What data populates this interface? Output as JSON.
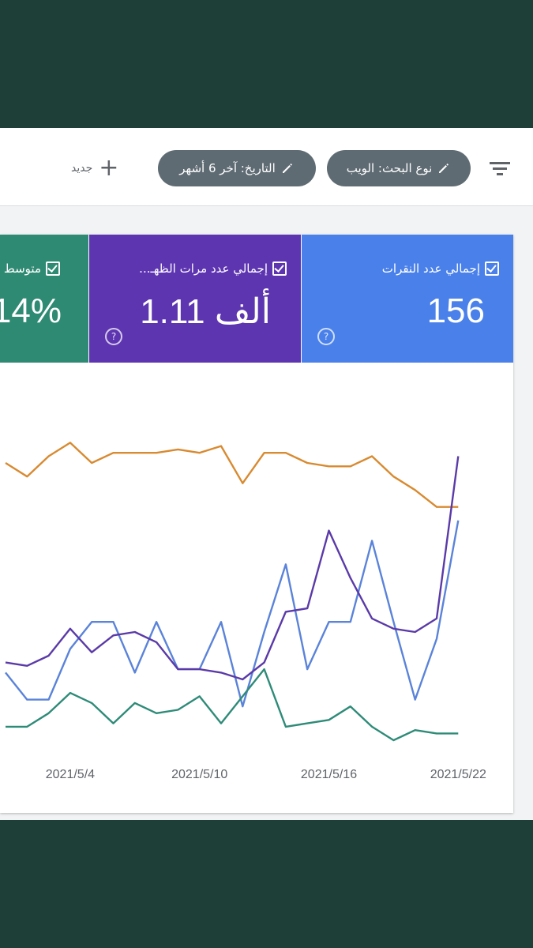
{
  "toolbar": {
    "filter_chips": [
      {
        "label": "نوع البحث: الويب"
      },
      {
        "label": "التاريخ: آخر 6 أشهر"
      }
    ],
    "new_label": "جديد"
  },
  "metrics": [
    {
      "label": "إجمالي عدد النقرات",
      "value": "156",
      "color": "#4a80ea",
      "checked": true
    },
    {
      "label": "إجمالي عدد مرات الظهـ...",
      "value": "1.11 ألف",
      "color": "#5e35b1",
      "checked": true
    },
    {
      "label": "متوسط",
      "value": "14%",
      "color": "#2f8a74",
      "checked": true
    }
  ],
  "chart_data": {
    "type": "line",
    "x": [
      "2021/5/1",
      "2021/5/2",
      "2021/5/3",
      "2021/5/4",
      "2021/5/5",
      "2021/5/6",
      "2021/5/7",
      "2021/5/8",
      "2021/5/9",
      "2021/5/10",
      "2021/5/11",
      "2021/5/12",
      "2021/5/13",
      "2021/5/14",
      "2021/5/15",
      "2021/5/16",
      "2021/5/17",
      "2021/5/18",
      "2021/5/19",
      "2021/5/20",
      "2021/5/21",
      "2021/5/22",
      "2021/5/23",
      "2021/5/24"
    ],
    "xticks": [
      "2021/5/4",
      "2021/5/10",
      "2021/5/16",
      "2021/5/22"
    ],
    "ylim": [
      0,
      100
    ],
    "series": [
      {
        "color": "#d88a30",
        "values": [
          82,
          78,
          84,
          88,
          82,
          85,
          85,
          85,
          86,
          85,
          87,
          76,
          85,
          85,
          82,
          81,
          81,
          84,
          78,
          74,
          69,
          69,
          null,
          null
        ]
      },
      {
        "color": "#5a83d9",
        "values": [
          20,
          12,
          12,
          27,
          35,
          35,
          20,
          35,
          21,
          21,
          35,
          10,
          32,
          52,
          21,
          35,
          35,
          59,
          35,
          12,
          30,
          65,
          null,
          null
        ]
      },
      {
        "color": "#5a3aa8",
        "values": [
          23,
          22,
          25,
          33,
          26,
          31,
          32,
          29,
          21,
          21,
          20,
          18,
          23,
          38,
          39,
          62,
          48,
          36,
          33,
          32,
          36,
          84,
          null,
          null
        ]
      },
      {
        "color": "#2e8b78",
        "values": [
          4,
          4,
          8,
          14,
          11,
          5,
          11,
          8,
          9,
          13,
          5,
          13,
          21,
          4,
          5,
          6,
          10,
          4,
          0,
          3,
          2,
          2,
          null,
          null
        ]
      }
    ]
  }
}
